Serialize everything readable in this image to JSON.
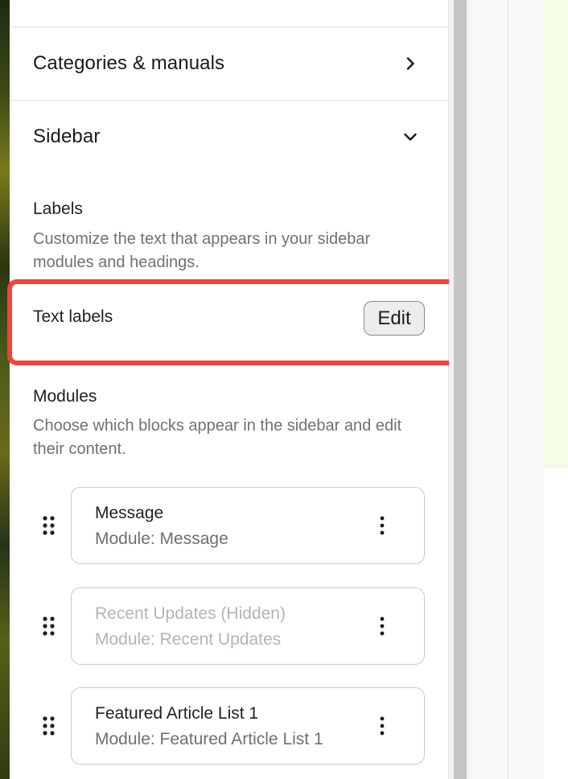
{
  "sections": {
    "categories": {
      "title": "Categories & manuals",
      "icon": "chevron-right-icon"
    },
    "sidebar": {
      "title": "Sidebar",
      "icon": "chevron-down-icon"
    }
  },
  "labels": {
    "title": "Labels",
    "description": "Customize the text that appears in your sidebar modules and headings.",
    "row_label": "Text labels",
    "edit_button": "Edit"
  },
  "modules": {
    "title": "Modules",
    "description": "Choose which blocks appear in the sidebar and edit their content.",
    "items": [
      {
        "name": "Message",
        "subtitle": "Module: Message",
        "hidden": false
      },
      {
        "name": "Recent Updates (Hidden)",
        "subtitle": "Module: Recent Updates",
        "hidden": true
      },
      {
        "name": "Featured Article List 1",
        "subtitle": "Module: Featured Article List 1",
        "hidden": false
      }
    ]
  },
  "colors": {
    "highlight": "#f2423a",
    "muted_text": "#707070",
    "hidden_text": "#b4b4b4"
  }
}
